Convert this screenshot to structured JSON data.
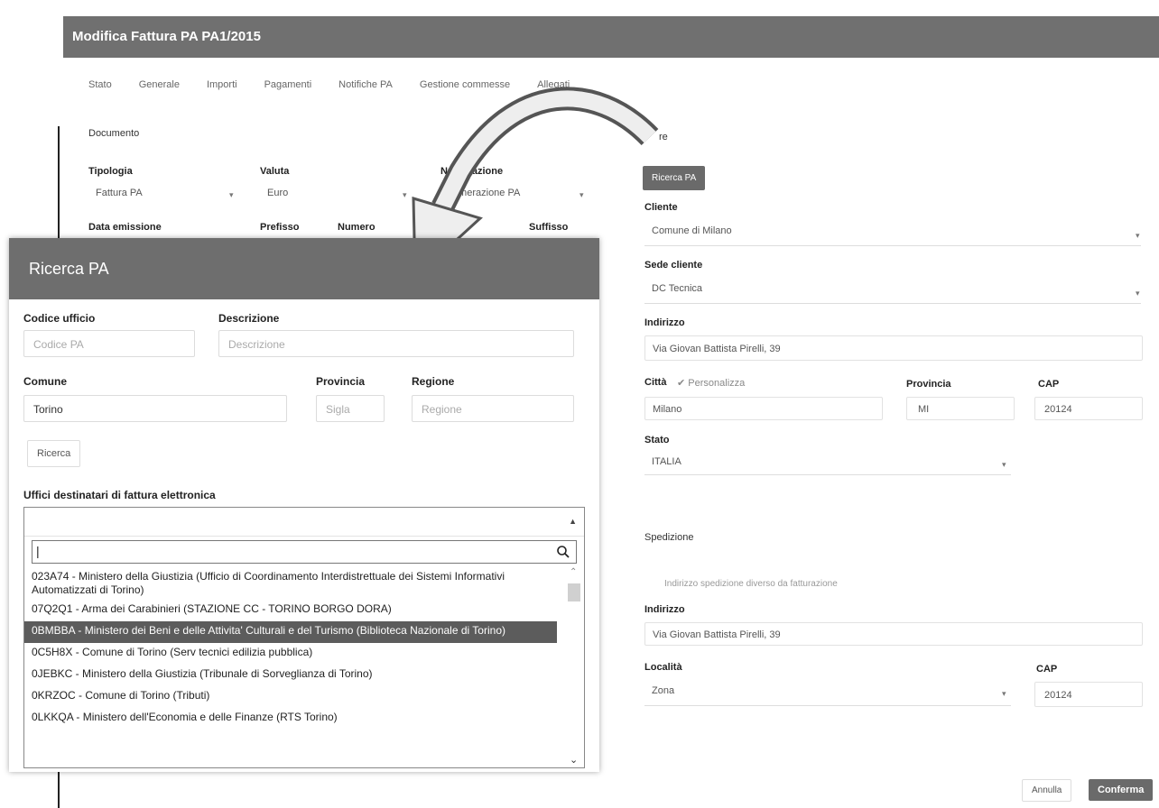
{
  "window": {
    "title": "Modifica Fattura PA PA1/2015",
    "tabs": [
      "Stato",
      "Generale",
      "Importi",
      "Pagamenti",
      "Notifiche PA",
      "Gestione commesse",
      "Allegati"
    ]
  },
  "documento": {
    "section_label": "Documento",
    "tipologia_label": "Tipologia",
    "tipologia_value": "Fattura PA",
    "valuta_label": "Valuta",
    "valuta_value": "Euro",
    "numerazione_label": "Numerazione",
    "numerazione_value": "Numerazione PA",
    "data_emissione_label": "Data emissione",
    "prefisso_label": "Prefisso",
    "numero_label": "Numero",
    "suffisso_label": "Suffisso"
  },
  "cliente": {
    "section_label": "re",
    "ricerca_pa_button": "Ricerca PA",
    "cliente_label": "Cliente",
    "cliente_value": "Comune di Milano",
    "sede_label": "Sede cliente",
    "sede_value": "DC Tecnica",
    "indirizzo_label": "Indirizzo",
    "indirizzo_value": "Via Giovan Battista Pirelli, 39",
    "citta_label": "Città",
    "personalizza_label": "Personalizza",
    "citta_value": "Milano",
    "provincia_label": "Provincia",
    "provincia_value": "MI",
    "cap_label": "CAP",
    "cap_value": "20124",
    "stato_label": "Stato",
    "stato_value": "ITALIA"
  },
  "spedizione": {
    "section_label": "Spedizione",
    "diverso_label": "Indirizzo spedizione diverso da fatturazione",
    "indirizzo_label": "Indirizzo",
    "indirizzo_value": "Via Giovan Battista Pirelli, 39",
    "localita_label": "Località",
    "localita_value": "Zona",
    "cap_label": "CAP",
    "cap_value": "20124"
  },
  "footer": {
    "annulla": "Annulla",
    "conferma": "Conferma"
  },
  "modal": {
    "title": "Ricerca PA",
    "codice_label": "Codice ufficio",
    "codice_placeholder": "Codice PA",
    "descrizione_label": "Descrizione",
    "descrizione_placeholder": "Descrizione",
    "comune_label": "Comune",
    "comune_value": "Torino",
    "provincia_label": "Provincia",
    "provincia_placeholder": "Sigla",
    "regione_label": "Regione",
    "regione_placeholder": "Regione",
    "ricerca_button": "Ricerca",
    "uffici_label": "Uffici destinatari di fattura elettronica",
    "search_value": "|",
    "items": [
      "023A74 - Ministero della Giustizia (Ufficio di Coordinamento Interdistrettuale dei Sistemi Informativi Automatizzati di Torino)",
      "07Q2Q1 - Arma dei Carabinieri (STAZIONE CC - TORINO BORGO DORA)",
      "0BMBBA - Ministero dei Beni e delle Attivita' Culturali e del Turismo (Biblioteca Nazionale di Torino)",
      "0C5H8X - Comune di Torino (Serv tecnici edilizia pubblica)",
      "0JEBKC - Ministero della Giustizia (Tribunale di Sorveglianza di Torino)",
      "0KRZOC - Comune di Torino (Tributi)",
      "0LKKQA - Ministero dell'Economia e delle Finanze (RTS Torino)"
    ],
    "selected_index": 2
  }
}
